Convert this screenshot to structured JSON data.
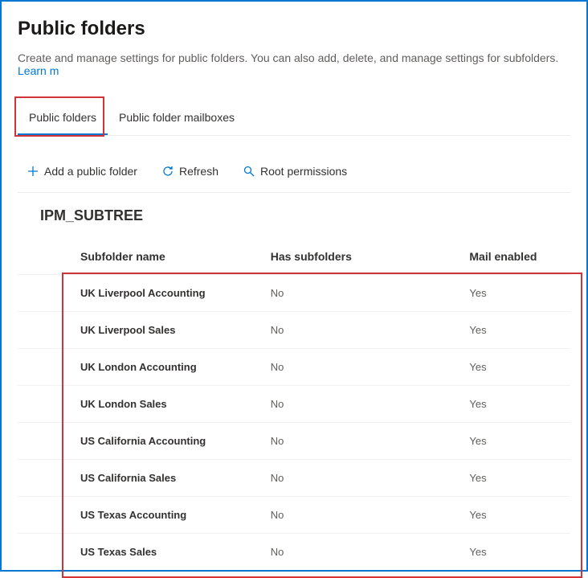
{
  "header": {
    "title": "Public folders",
    "description_prefix": "Create and manage settings for public folders. You can also add, delete, and manage settings for subfolders. ",
    "learn_link": "Learn m"
  },
  "tabs": [
    {
      "label": "Public folders",
      "active": true
    },
    {
      "label": "Public folder mailboxes",
      "active": false
    }
  ],
  "toolbar": {
    "add_label": "Add a public folder",
    "refresh_label": "Refresh",
    "root_perm_label": "Root permissions"
  },
  "section_title": "IPM_SUBTREE",
  "table": {
    "columns": [
      "Subfolder name",
      "Has subfolders",
      "Mail enabled"
    ],
    "rows": [
      {
        "name": "UK Liverpool Accounting",
        "has_subfolders": "No",
        "mail_enabled": "Yes"
      },
      {
        "name": "UK Liverpool Sales",
        "has_subfolders": "No",
        "mail_enabled": "Yes"
      },
      {
        "name": "UK London Accounting",
        "has_subfolders": "No",
        "mail_enabled": "Yes"
      },
      {
        "name": "UK London Sales",
        "has_subfolders": "No",
        "mail_enabled": "Yes"
      },
      {
        "name": "US California Accounting",
        "has_subfolders": "No",
        "mail_enabled": "Yes"
      },
      {
        "name": "US California Sales",
        "has_subfolders": "No",
        "mail_enabled": "Yes"
      },
      {
        "name": "US Texas Accounting",
        "has_subfolders": "No",
        "mail_enabled": "Yes"
      },
      {
        "name": "US Texas Sales",
        "has_subfolders": "No",
        "mail_enabled": "Yes"
      }
    ]
  }
}
